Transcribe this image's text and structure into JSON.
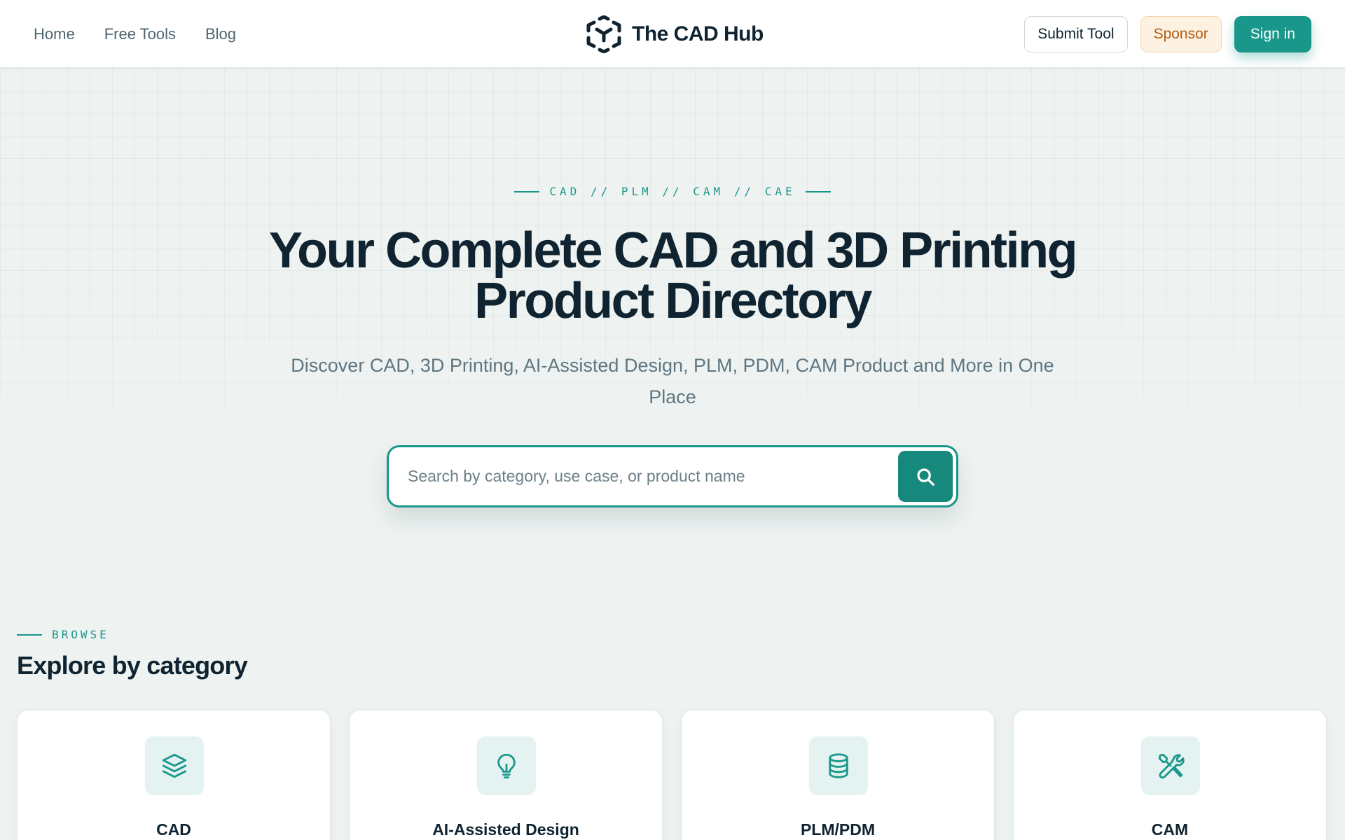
{
  "nav": {
    "links": [
      "Home",
      "Free Tools",
      "Blog"
    ],
    "brand": "The CAD Hub",
    "submit_label": "Submit Tool",
    "sponsor_label": "Sponsor",
    "signin_label": "Sign in"
  },
  "hero": {
    "eyebrow": "CAD // PLM // CAM // CAE",
    "title": "Your Complete CAD and 3D Printing Product Directory",
    "subtitle": "Discover CAD, 3D Printing, AI-Assisted Design, PLM, PDM, CAM Product and More in One Place"
  },
  "search": {
    "placeholder": "Search by category, use case, or product name",
    "value": ""
  },
  "browse": {
    "eyebrow": "BROWSE",
    "title": "Explore by category",
    "categories": [
      {
        "label": "CAD",
        "icon": "layers-icon"
      },
      {
        "label": "AI-Assisted Design",
        "icon": "lightbulb-icon"
      },
      {
        "label": "PLM/PDM",
        "icon": "database-icon"
      },
      {
        "label": "CAM",
        "icon": "tools-icon"
      }
    ]
  },
  "colors": {
    "accent": "#18978a",
    "text": "#0f2430",
    "muted": "#5f7580",
    "sponsor": "#b55c12",
    "background": "#eef3f2"
  }
}
